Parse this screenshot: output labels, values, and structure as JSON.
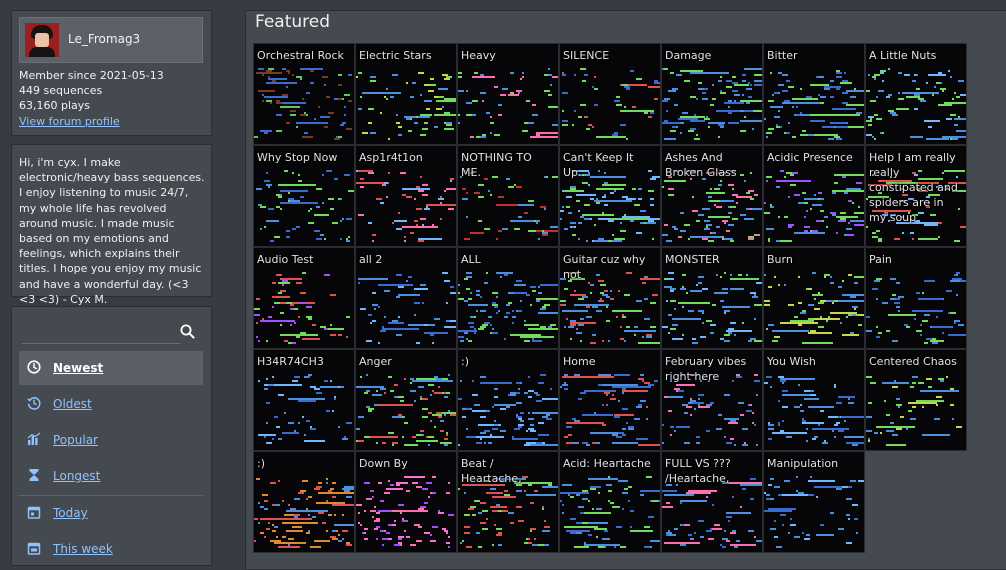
{
  "profile": {
    "username": "Le_Fromag3",
    "member_since": "Member since 2021-05-13",
    "sequences": "449 sequences",
    "plays": "63,160 plays",
    "forum_link": "View forum profile"
  },
  "bio": "Hi, i'm cyx. I make electronic/heavy bass sequences. I enjoy listening to music 24/7, my whole life has revolved around music. I made music based on my emotions and feelings, which explains their titles. I hope you enjoy my music and have a wonderful day. (<3 <3 <3) - Cyx M.",
  "search": {
    "placeholder": ""
  },
  "sort_options": [
    {
      "label": "Newest",
      "icon": "clock-icon",
      "active": true
    },
    {
      "label": "Oldest",
      "icon": "history-icon",
      "active": false
    },
    {
      "label": "Popular",
      "icon": "bar-chart-icon",
      "active": false
    },
    {
      "label": "Longest",
      "icon": "hourglass-icon",
      "active": false
    },
    {
      "label": "Today",
      "icon": "calendar-icon",
      "active": false
    },
    {
      "label": "This week",
      "icon": "calendar-icon",
      "active": false
    }
  ],
  "featured": {
    "title": "Featured",
    "sequences": [
      {
        "title": "Orchestral Rock",
        "colors": [
          "#7a3a22",
          "#3a6bd0",
          "#55cc66"
        ]
      },
      {
        "title": "Electric Stars",
        "colors": [
          "#c6d84a",
          "#4a8fe0",
          "#6fdc5a"
        ]
      },
      {
        "title": "Heavy",
        "colors": [
          "#6fdc5a",
          "#ff6fb0",
          "#4a8fe0"
        ]
      },
      {
        "title": "SILENCE",
        "colors": [
          "#6fdc5a",
          "#3a6bd0",
          "#e05050"
        ]
      },
      {
        "title": "Damage",
        "colors": [
          "#6fdc5a",
          "#4a8fe0",
          "#3a6bd0"
        ]
      },
      {
        "title": "Bitter",
        "colors": [
          "#3a6bd0",
          "#4a8fe0",
          "#6fdc5a"
        ]
      },
      {
        "title": "A Little Nuts",
        "colors": [
          "#6fdc5a",
          "#6fb7ff",
          "#4a8fe0"
        ]
      },
      {
        "title": "Why Stop Now",
        "colors": [
          "#6fdc5a",
          "#4a8fe0",
          "#3a6bd0"
        ]
      },
      {
        "title": "Asp1r4t1on",
        "colors": [
          "#e05050",
          "#6fb7ff",
          "#ff6fb0"
        ]
      },
      {
        "title": "NOTHING TO ME.",
        "colors": [
          "#c03030",
          "#6fdc5a",
          "#4a8fe0"
        ]
      },
      {
        "title": "Can't Keep It Up..",
        "colors": [
          "#6fdc5a",
          "#4a8fe0",
          "#6fb7ff"
        ]
      },
      {
        "title": "Ashes And Broken Glass",
        "colors": [
          "#6fdc5a",
          "#ff6fb0",
          "#4a8fe0"
        ]
      },
      {
        "title": "Acidic Presence",
        "colors": [
          "#6fdc5a",
          "#a050ff",
          "#4a8fe0"
        ]
      },
      {
        "title": "Help I am really really constipated and spiders are in my soup",
        "colors": [
          "#e05050",
          "#6fb7ff",
          "#6fdc5a"
        ]
      },
      {
        "title": "Audio Test",
        "colors": [
          "#6fdc5a",
          "#a050ff",
          "#e05050"
        ]
      },
      {
        "title": "all 2",
        "colors": [
          "#6fb7ff",
          "#4a8fe0",
          "#3a6bd0"
        ]
      },
      {
        "title": "ALL",
        "colors": [
          "#6fdc5a",
          "#4a8fe0",
          "#3a6bd0"
        ]
      },
      {
        "title": "Guitar cuz why not",
        "colors": [
          "#6fdc5a",
          "#4a8fe0",
          "#e05050"
        ]
      },
      {
        "title": "MONSTER",
        "colors": [
          "#6fb7ff",
          "#4a8fe0",
          "#6fdc5a"
        ]
      },
      {
        "title": "Burn",
        "colors": [
          "#c6d84a",
          "#6fdc5a",
          "#4a8fe0"
        ]
      },
      {
        "title": "Pain",
        "colors": [
          "#4a8fe0",
          "#3a6bd0",
          "#6fdc5a"
        ]
      },
      {
        "title": "H34R74CH3",
        "colors": [
          "#4a8fe0",
          "#3a6bd0",
          "#6fb7ff"
        ]
      },
      {
        "title": "Anger",
        "colors": [
          "#e05050",
          "#6fdc5a",
          "#4a8fe0"
        ]
      },
      {
        "title": ":)",
        "colors": [
          "#4a8fe0",
          "#3a6bd0",
          "#6fb7ff"
        ]
      },
      {
        "title": "Home",
        "colors": [
          "#4a8fe0",
          "#e05050",
          "#3a6bd0"
        ]
      },
      {
        "title": "February vibes right here",
        "colors": [
          "#4a8fe0",
          "#ff6fb0",
          "#3a6bd0"
        ]
      },
      {
        "title": "You Wish",
        "colors": [
          "#4a8fe0",
          "#3a6bd0",
          "#6fb7ff"
        ]
      },
      {
        "title": "Centered Chaos",
        "colors": [
          "#c6d84a",
          "#6fdc5a",
          "#4a8fe0"
        ]
      },
      {
        "title": ":)",
        "colors": [
          "#e08a30",
          "#e05050",
          "#4a8fe0"
        ]
      },
      {
        "title": "Down By",
        "colors": [
          "#ff6fd8",
          "#ff6fb0",
          "#a050ff"
        ]
      },
      {
        "title": "Beat / Heartache,",
        "colors": [
          "#6fdc5a",
          "#4a8fe0",
          "#e05050"
        ]
      },
      {
        "title": "Acid: Heartache",
        "colors": [
          "#4a8fe0",
          "#6fdc5a",
          "#3a6bd0"
        ]
      },
      {
        "title": "FULL VS ??? /Heartache,",
        "colors": [
          "#4a8fe0",
          "#ff6fb0",
          "#3a6bd0"
        ]
      },
      {
        "title": "Manipulation",
        "colors": [
          "#4a8fe0",
          "#3a6bd0",
          "#6fb7ff"
        ]
      }
    ]
  }
}
